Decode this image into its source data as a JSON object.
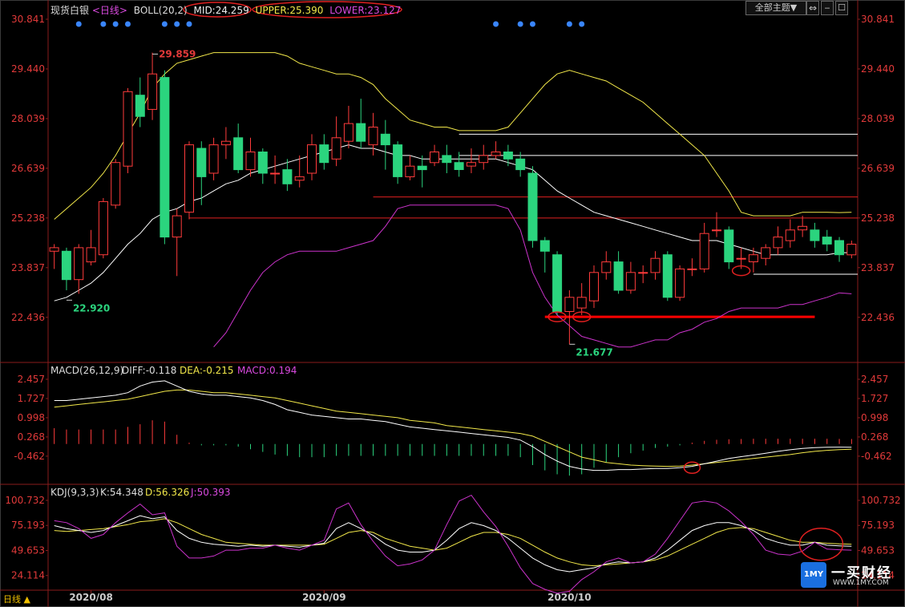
{
  "header": {
    "title": "现货白银",
    "period_tag": "<日线>",
    "boll_name": "BOLL(20,2)",
    "mid": "MID:24.259",
    "upper": "UPPER:25.390",
    "lower": "LOWER:23.127",
    "theme_button": "全部主题",
    "theme_arrow": "▼"
  },
  "period_footer": "日线 ▲",
  "logo": {
    "text": "1MY",
    "name": "一买财经",
    "url": "WWW.1MY.COM"
  },
  "colors": {
    "up": "#ff3b3b",
    "down": "#2bd47e",
    "mid": "#ffffff",
    "upper": "#f2e84a",
    "lower": "#cc33cc",
    "axis_text": "#e23a3a",
    "hline_red": "#e02020",
    "hline_white": "#ffffff",
    "marker": "#e02020",
    "dots": "#3a86ff"
  },
  "chart_data": [
    {
      "type": "candlestick",
      "panel": "price",
      "y_ticks": [
        "30.841",
        "29.440",
        "28.039",
        "26.639",
        "25.238",
        "23.837",
        "22.436"
      ],
      "ylim": [
        21.3,
        30.841
      ],
      "x_ticks": [
        {
          "index": 3,
          "label": "2020/08"
        },
        {
          "index": 22,
          "label": "2020/09"
        },
        {
          "index": 42,
          "label": "2020/10"
        }
      ],
      "candles": [
        [
          24.3,
          24.4,
          23.8,
          24.5
        ],
        [
          24.3,
          23.5,
          23.2,
          24.4
        ],
        [
          23.5,
          24.4,
          23.1,
          24.5
        ],
        [
          24.0,
          24.4,
          23.9,
          24.9
        ],
        [
          24.2,
          25.7,
          24.1,
          25.8
        ],
        [
          25.6,
          26.8,
          25.5,
          26.9
        ],
        [
          26.7,
          28.8,
          26.5,
          28.9
        ],
        [
          28.7,
          28.1,
          27.8,
          29.2
        ],
        [
          28.3,
          29.3,
          28.0,
          29.9
        ],
        [
          29.2,
          24.7,
          24.5,
          29.4
        ],
        [
          24.7,
          25.3,
          23.6,
          25.5
        ],
        [
          25.4,
          27.3,
          25.2,
          27.4
        ],
        [
          27.2,
          26.4,
          25.6,
          27.4
        ],
        [
          26.5,
          27.3,
          26.3,
          27.5
        ],
        [
          27.3,
          27.4,
          26.9,
          27.8
        ],
        [
          27.5,
          26.6,
          26.5,
          27.9
        ],
        [
          26.6,
          27.1,
          26.4,
          27.5
        ],
        [
          27.1,
          26.5,
          26.2,
          27.2
        ],
        [
          26.5,
          26.5,
          26.2,
          27.0
        ],
        [
          26.6,
          26.2,
          26.0,
          26.9
        ],
        [
          26.3,
          26.4,
          26.1,
          27.0
        ],
        [
          26.5,
          27.3,
          26.3,
          27.6
        ],
        [
          27.3,
          26.8,
          26.6,
          27.6
        ],
        [
          26.9,
          27.5,
          26.7,
          28.1
        ],
        [
          27.4,
          27.9,
          27.2,
          28.4
        ],
        [
          27.9,
          27.4,
          27.2,
          28.6
        ],
        [
          27.3,
          27.8,
          27.0,
          28.2
        ],
        [
          27.6,
          27.3,
          26.6,
          28.0
        ],
        [
          27.3,
          26.4,
          26.2,
          27.4
        ],
        [
          26.4,
          26.7,
          26.3,
          27.0
        ],
        [
          26.7,
          26.6,
          26.1,
          27.0
        ],
        [
          26.8,
          27.1,
          26.7,
          27.3
        ],
        [
          27.0,
          26.8,
          26.5,
          27.3
        ],
        [
          26.8,
          26.6,
          26.4,
          27.1
        ],
        [
          26.7,
          26.8,
          26.5,
          27.2
        ],
        [
          26.8,
          27.0,
          26.6,
          27.3
        ],
        [
          27.0,
          27.1,
          26.9,
          27.4
        ],
        [
          27.1,
          26.9,
          26.7,
          27.3
        ],
        [
          26.9,
          26.6,
          26.4,
          27.1
        ],
        [
          26.5,
          24.6,
          24.4,
          26.7
        ],
        [
          24.6,
          24.3,
          23.7,
          24.7
        ],
        [
          24.2,
          22.6,
          22.5,
          24.3
        ],
        [
          22.6,
          23.0,
          21.677,
          23.2
        ],
        [
          22.7,
          23.0,
          22.5,
          23.4
        ],
        [
          22.9,
          23.7,
          22.7,
          23.9
        ],
        [
          23.7,
          24.0,
          23.5,
          24.3
        ],
        [
          24.0,
          23.2,
          23.1,
          24.3
        ],
        [
          23.2,
          23.7,
          23.1,
          24.0
        ],
        [
          23.7,
          23.7,
          23.4,
          23.9
        ],
        [
          23.7,
          24.1,
          23.5,
          24.3
        ],
        [
          24.2,
          23.0,
          22.9,
          24.3
        ],
        [
          23.0,
          23.8,
          22.9,
          23.9
        ],
        [
          23.8,
          23.8,
          23.6,
          24.1
        ],
        [
          23.8,
          24.8,
          23.7,
          25.1
        ],
        [
          24.9,
          24.9,
          24.7,
          25.4
        ],
        [
          24.9,
          24.0,
          23.8,
          25.0
        ],
        [
          24.1,
          24.1,
          23.8,
          24.4
        ],
        [
          24.0,
          24.2,
          23.7,
          24.4
        ],
        [
          24.1,
          24.4,
          23.9,
          24.5
        ],
        [
          24.4,
          24.7,
          24.2,
          25.0
        ],
        [
          24.6,
          24.9,
          24.4,
          25.2
        ],
        [
          24.9,
          25.0,
          24.7,
          25.3
        ],
        [
          24.9,
          24.6,
          24.4,
          25.1
        ],
        [
          24.7,
          24.5,
          24.3,
          24.9
        ],
        [
          24.6,
          24.2,
          24.0,
          24.7
        ],
        [
          24.2,
          24.5,
          24.1,
          24.6
        ]
      ],
      "boll": {
        "mid": [
          22.9,
          23.0,
          23.2,
          23.4,
          23.7,
          24.1,
          24.5,
          24.8,
          25.2,
          25.4,
          25.5,
          25.7,
          25.8,
          26.0,
          26.2,
          26.3,
          26.5,
          26.6,
          26.7,
          26.8,
          26.9,
          27.0,
          27.1,
          27.2,
          27.3,
          27.2,
          27.2,
          27.1,
          27.0,
          27.0,
          26.9,
          26.9,
          26.9,
          26.9,
          26.9,
          26.9,
          26.9,
          26.8,
          26.7,
          26.6,
          26.3,
          26.0,
          25.8,
          25.6,
          25.4,
          25.3,
          25.2,
          25.1,
          25.0,
          24.9,
          24.8,
          24.7,
          24.6,
          24.6,
          24.6,
          24.5,
          24.4,
          24.3,
          24.2,
          24.2,
          24.2,
          24.2,
          24.2,
          24.2,
          24.259,
          24.26
        ],
        "upper": [
          25.2,
          25.5,
          25.8,
          26.1,
          26.5,
          27.0,
          27.6,
          28.2,
          28.9,
          29.3,
          29.6,
          29.7,
          29.8,
          29.9,
          29.9,
          29.9,
          29.9,
          29.9,
          29.9,
          29.8,
          29.6,
          29.5,
          29.4,
          29.3,
          29.3,
          29.2,
          29.0,
          28.6,
          28.3,
          28.0,
          27.9,
          27.8,
          27.8,
          27.7,
          27.7,
          27.7,
          27.7,
          27.8,
          28.2,
          28.6,
          29.0,
          29.3,
          29.4,
          29.3,
          29.2,
          29.1,
          28.9,
          28.7,
          28.5,
          28.2,
          27.9,
          27.6,
          27.3,
          27.0,
          26.5,
          26.0,
          25.4,
          25.3,
          25.3,
          25.3,
          25.3,
          25.4,
          25.4,
          25.4,
          25.39,
          25.4
        ],
        "lower": [
          null,
          null,
          null,
          null,
          null,
          null,
          null,
          null,
          null,
          null,
          null,
          null,
          null,
          21.6,
          22.0,
          22.6,
          23.2,
          23.7,
          24.0,
          24.2,
          24.3,
          24.3,
          24.3,
          24.3,
          24.4,
          24.5,
          24.6,
          25.0,
          25.5,
          25.6,
          25.6,
          25.6,
          25.6,
          25.6,
          25.6,
          25.6,
          25.6,
          25.5,
          24.9,
          23.7,
          23.0,
          22.5,
          22.2,
          21.9,
          21.8,
          21.7,
          21.6,
          21.6,
          21.7,
          21.8,
          21.8,
          22.0,
          22.1,
          22.3,
          22.4,
          22.6,
          22.7,
          22.7,
          22.7,
          22.7,
          22.8,
          22.8,
          22.9,
          23.0,
          23.127,
          23.1
        ]
      },
      "labels": [
        {
          "index": 8,
          "value": 29.859,
          "text": "29.859"
        },
        {
          "index": 1,
          "value": 22.92,
          "text": "22.920"
        },
        {
          "index": 42,
          "value": 21.677,
          "text": "21.677"
        }
      ],
      "hlines": [
        {
          "y": 25.238,
          "x0": 11,
          "color": "#e02020",
          "width": 1
        },
        {
          "y": 25.83,
          "x0": 26,
          "color": "#e02020",
          "width": 1
        },
        {
          "y": 27.0,
          "x0": 33,
          "color": "#ffffff",
          "width": 1
        },
        {
          "y": 27.6,
          "x0": 33,
          "color": "#ffffff",
          "width": 1
        },
        {
          "y": 23.65,
          "x0": 57,
          "color": "#ffffff",
          "width": 1
        },
        {
          "y": 22.45,
          "x0": 40,
          "x1": 62,
          "color": "#ff0000",
          "width": 3
        }
      ],
      "markers": [
        {
          "index": 41,
          "value": 22.45
        },
        {
          "index": 43,
          "value": 22.45
        },
        {
          "index": 56,
          "value": 23.75
        }
      ],
      "dots_at": [
        2,
        4,
        5,
        6,
        9,
        10,
        11,
        36,
        38,
        39,
        42,
        43
      ]
    },
    {
      "type": "macd",
      "panel": "macd",
      "title": "MACD(26,12,9)",
      "diff_label": "DIFF:-0.118",
      "dea_label": "DEA:-0.215",
      "macd_label": "MACD:0.194",
      "y_ticks": [
        "2.457",
        "1.727",
        "0.998",
        "0.268",
        "-0.462"
      ],
      "ylim": [
        -1.5,
        2.457
      ],
      "diff": [
        1.65,
        1.65,
        1.7,
        1.75,
        1.8,
        1.85,
        1.95,
        2.2,
        2.35,
        2.4,
        2.2,
        2.0,
        1.9,
        1.85,
        1.85,
        1.8,
        1.75,
        1.65,
        1.5,
        1.3,
        1.2,
        1.1,
        1.05,
        1.0,
        0.95,
        0.95,
        0.9,
        0.85,
        0.75,
        0.65,
        0.6,
        0.55,
        0.5,
        0.45,
        0.4,
        0.35,
        0.3,
        0.25,
        0.15,
        -0.1,
        -0.4,
        -0.65,
        -0.85,
        -0.95,
        -1.0,
        -1.0,
        -0.97,
        -0.97,
        -0.95,
        -0.93,
        -0.93,
        -0.9,
        -0.85,
        -0.75,
        -0.65,
        -0.55,
        -0.48,
        -0.42,
        -0.35,
        -0.28,
        -0.22,
        -0.17,
        -0.14,
        -0.12,
        -0.118,
        -0.12
      ],
      "dea": [
        1.4,
        1.45,
        1.5,
        1.55,
        1.6,
        1.65,
        1.7,
        1.8,
        1.9,
        2.0,
        2.05,
        2.05,
        2.0,
        1.95,
        1.95,
        1.9,
        1.85,
        1.8,
        1.75,
        1.65,
        1.55,
        1.45,
        1.35,
        1.25,
        1.2,
        1.15,
        1.1,
        1.05,
        1.0,
        0.9,
        0.85,
        0.8,
        0.7,
        0.65,
        0.6,
        0.55,
        0.5,
        0.45,
        0.4,
        0.3,
        0.1,
        -0.1,
        -0.3,
        -0.5,
        -0.6,
        -0.7,
        -0.75,
        -0.8,
        -0.82,
        -0.84,
        -0.85,
        -0.84,
        -0.8,
        -0.75,
        -0.7,
        -0.65,
        -0.6,
        -0.55,
        -0.5,
        -0.45,
        -0.4,
        -0.33,
        -0.28,
        -0.24,
        -0.215,
        -0.2
      ],
      "macd": [
        0.6,
        0.55,
        0.55,
        0.55,
        0.55,
        0.55,
        0.65,
        0.75,
        0.9,
        0.85,
        0.35,
        0.05,
        -0.05,
        -0.05,
        -0.05,
        -0.1,
        -0.2,
        -0.3,
        -0.4,
        -0.45,
        -0.5,
        -0.5,
        -0.5,
        -0.45,
        -0.45,
        -0.45,
        -0.45,
        -0.45,
        -0.45,
        -0.45,
        -0.45,
        -0.45,
        -0.45,
        -0.45,
        -0.45,
        -0.45,
        -0.45,
        -0.45,
        -0.5,
        -0.8,
        -1.0,
        -1.15,
        -1.2,
        -1.15,
        -0.9,
        -0.7,
        -0.5,
        -0.35,
        -0.25,
        -0.15,
        -0.1,
        -0.05,
        0.05,
        0.12,
        0.16,
        0.18,
        0.19,
        0.2,
        0.2,
        0.2,
        0.2,
        0.2,
        0.2,
        0.2,
        0.194,
        0.19
      ],
      "markers": [
        {
          "index": 52,
          "value": -0.9
        }
      ]
    },
    {
      "type": "kdj",
      "panel": "kdj",
      "title": "KDJ(9,3,3)",
      "k_label": "K:54.348",
      "d_label": "D:56.326",
      "j_label": "J:50.393",
      "y_ticks": [
        "100.732",
        "75.193",
        "49.653",
        "24.114"
      ],
      "ylim": [
        10,
        100.732
      ],
      "k": [
        75,
        72,
        70,
        68,
        70,
        75,
        80,
        85,
        82,
        84,
        70,
        62,
        58,
        56,
        55,
        54,
        55,
        54,
        55,
        54,
        53,
        55,
        57,
        72,
        78,
        72,
        65,
        56,
        50,
        48,
        48,
        50,
        60,
        72,
        78,
        75,
        70,
        62,
        52,
        42,
        35,
        30,
        28,
        30,
        32,
        36,
        38,
        37,
        38,
        42,
        50,
        60,
        70,
        75,
        78,
        78,
        75,
        70,
        62,
        58,
        55,
        55,
        58,
        55,
        54.348,
        54
      ],
      "d": [
        70,
        69,
        70,
        71,
        72,
        74,
        76,
        79,
        80,
        82,
        78,
        72,
        66,
        62,
        58,
        57,
        56,
        55,
        55,
        55,
        55,
        55,
        56,
        62,
        68,
        70,
        68,
        62,
        58,
        54,
        52,
        50,
        52,
        58,
        64,
        68,
        68,
        66,
        62,
        55,
        48,
        42,
        38,
        35,
        34,
        35,
        36,
        37,
        38,
        40,
        44,
        50,
        56,
        62,
        68,
        72,
        73,
        72,
        68,
        64,
        60,
        58,
        58,
        57,
        56.326,
        56
      ],
      "j": [
        80,
        78,
        72,
        62,
        66,
        78,
        88,
        97,
        86,
        88,
        54,
        42,
        42,
        44,
        50,
        50,
        52,
        52,
        55,
        52,
        50,
        55,
        60,
        92,
        98,
        76,
        59,
        44,
        34,
        36,
        40,
        50,
        76,
        100,
        106,
        89,
        74,
        54,
        32,
        16,
        10,
        6,
        8,
        20,
        28,
        38,
        42,
        37,
        38,
        46,
        62,
        80,
        98,
        100,
        98,
        90,
        79,
        66,
        50,
        46,
        45,
        49,
        58,
        51,
        50.393,
        50
      ],
      "markers": [
        {
          "index": 62,
          "value": 56
        }
      ]
    }
  ]
}
